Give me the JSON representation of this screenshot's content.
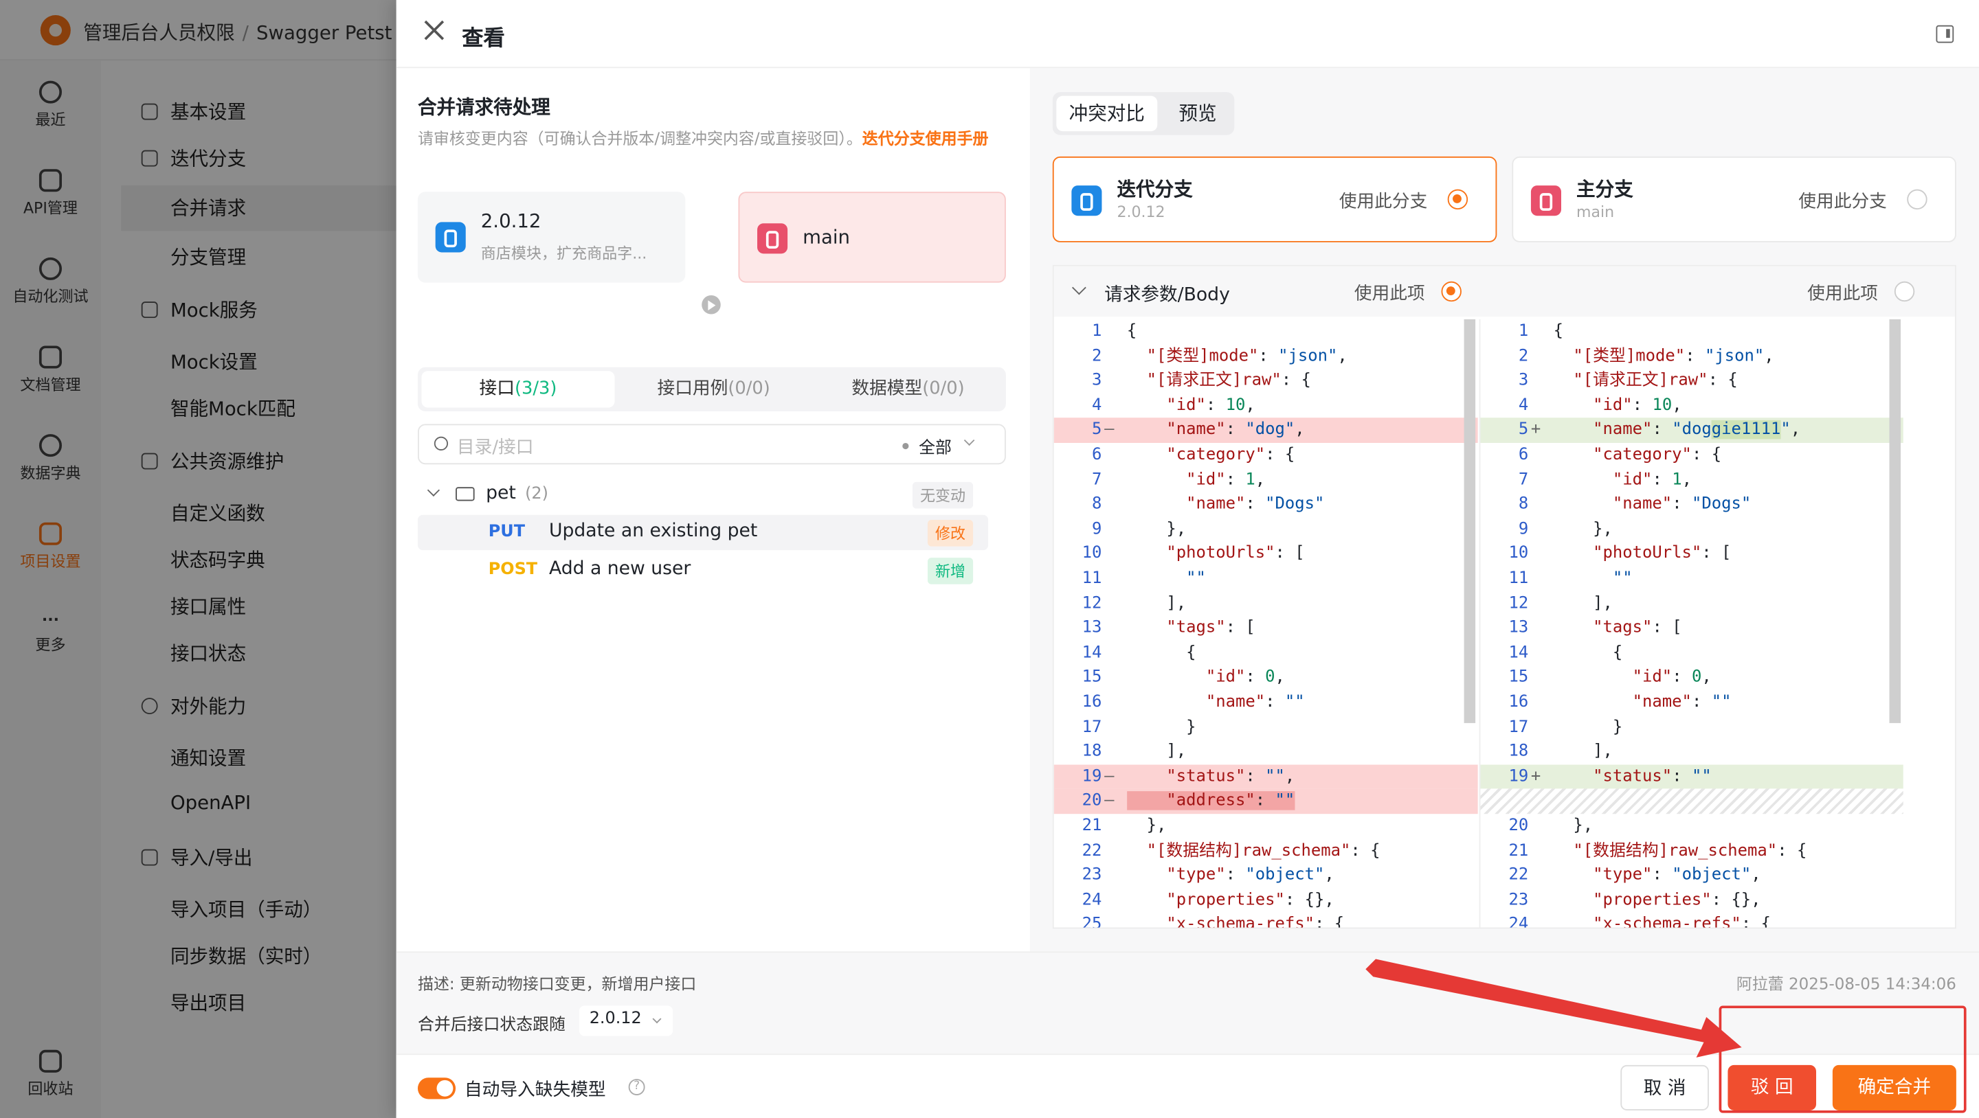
{
  "header": {
    "breadcrumb": [
      "管理后台人员权限",
      "Swagger Petst"
    ]
  },
  "rail": [
    {
      "label": "最近"
    },
    {
      "label": "API管理"
    },
    {
      "label": "自动化测试"
    },
    {
      "label": "文档管理"
    },
    {
      "label": "数据字典"
    },
    {
      "label": "项目设置"
    },
    {
      "label": "更多"
    },
    {
      "label": "回收站"
    }
  ],
  "menu": {
    "basic": "基本设置",
    "iter": "迭代分支",
    "merge": "合并请求",
    "branch": "分支管理",
    "mock": "Mock服务",
    "mockset": "Mock设置",
    "mockmatch": "智能Mock匹配",
    "public": "公共资源维护",
    "func": "自定义函数",
    "status": "状态码字典",
    "attr": "接口属性",
    "istate": "接口状态",
    "ext": "对外能力",
    "notify": "通知设置",
    "openapi": "OpenAPI",
    "io": "导入/导出",
    "importm": "导入项目（手动）",
    "sync": "同步数据（实时）",
    "export": "导出项目"
  },
  "drawer": {
    "title": "查看"
  },
  "left": {
    "heading": "合并请求待处理",
    "desc": "请审核变更内容（可确认合并版本/调整冲突内容/或直接驳回）。",
    "link": "迭代分支使用手册",
    "source": {
      "version": "2.0.12",
      "sub": "商店模块，扩充商品字..."
    },
    "target": {
      "name": "main"
    },
    "tabs": [
      {
        "label": "接口",
        "count": "(3/3)"
      },
      {
        "label": "接口用例",
        "count": "(0/0)"
      },
      {
        "label": "数据模型",
        "count": "(0/0)"
      }
    ],
    "search": {
      "placeholder": "目录/接口",
      "filter": "全部"
    },
    "folder": {
      "name": "pet",
      "count": "(2)",
      "badge": "无变动"
    },
    "rows": [
      {
        "method": "PUT",
        "name": "Update an existing pet",
        "badge": "修改"
      },
      {
        "method": "POST",
        "name": "Add a new user",
        "badge": "新增"
      }
    ]
  },
  "right": {
    "tabs": [
      "冲突对比",
      "预览"
    ],
    "branches": [
      {
        "title": "迭代分支",
        "sub": "2.0.12",
        "use": "使用此分支"
      },
      {
        "title": "主分支",
        "sub": "main",
        "use": "使用此分支"
      }
    ],
    "section": "请求参数/Body",
    "use_item": "使用此项"
  },
  "footer": {
    "desc": "描述: 更新动物接口变更，新增用户接口",
    "meta": "阿拉蕾 2025-08-05 14:34:06",
    "follow": "合并后接口状态跟随",
    "follow_value": "2.0.12",
    "auto": "自动导入缺失模型",
    "q": "?",
    "cancel": "取 消",
    "reject": "驳 回",
    "merge": "确定合并"
  },
  "colors": {
    "accent": "#f97316",
    "reject": "#f04e2f",
    "annotation": "#e53935"
  },
  "code_left": [
    [
      "1",
      "",
      "{"
    ],
    [
      "2",
      "",
      "  \"[类型]mode\": \"json\","
    ],
    [
      "3",
      "",
      "  \"[请求正文]raw\": {"
    ],
    [
      "4",
      "",
      "    \"id\": 10,"
    ],
    [
      "5",
      "—",
      "    \"name\": \"dog\","
    ],
    [
      "6",
      "",
      "    \"category\": {"
    ],
    [
      "7",
      "",
      "      \"id\": 1,"
    ],
    [
      "8",
      "",
      "      \"name\": \"Dogs\""
    ],
    [
      "9",
      "",
      "    },"
    ],
    [
      "10",
      "",
      "    \"photoUrls\": ["
    ],
    [
      "11",
      "",
      "      \"\""
    ],
    [
      "12",
      "",
      "    ],"
    ],
    [
      "13",
      "",
      "    \"tags\": ["
    ],
    [
      "14",
      "",
      "      {"
    ],
    [
      "15",
      "",
      "        \"id\": 0,"
    ],
    [
      "16",
      "",
      "        \"name\": \"\""
    ],
    [
      "17",
      "",
      "      }"
    ],
    [
      "18",
      "",
      "    ],"
    ],
    [
      "19",
      "—",
      "    \"status\": \"\","
    ],
    [
      "20",
      "—",
      "    \"address\": \"\""
    ],
    [
      "21",
      "",
      "  },"
    ],
    [
      "22",
      "",
      "  \"[数据结构]raw_schema\": {"
    ],
    [
      "23",
      "",
      "    \"type\": \"object\","
    ],
    [
      "24",
      "",
      "    \"properties\": {},"
    ],
    [
      "25",
      "",
      "    \"x-schema-refs\": {"
    ]
  ],
  "code_right": [
    [
      "1",
      "",
      "{"
    ],
    [
      "2",
      "",
      "  \"[类型]mode\": \"json\","
    ],
    [
      "3",
      "",
      "  \"[请求正文]raw\": {"
    ],
    [
      "4",
      "",
      "    \"id\": 10,"
    ],
    [
      "5",
      "+",
      "    \"name\": \"doggie1111\","
    ],
    [
      "6",
      "",
      "    \"category\": {"
    ],
    [
      "7",
      "",
      "      \"id\": 1,"
    ],
    [
      "8",
      "",
      "      \"name\": \"Dogs\""
    ],
    [
      "9",
      "",
      "    },"
    ],
    [
      "10",
      "",
      "    \"photoUrls\": ["
    ],
    [
      "11",
      "",
      "      \"\""
    ],
    [
      "12",
      "",
      "    ],"
    ],
    [
      "13",
      "",
      "    \"tags\": ["
    ],
    [
      "14",
      "",
      "      {"
    ],
    [
      "15",
      "",
      "        \"id\": 0,"
    ],
    [
      "16",
      "",
      "        \"name\": \"\""
    ],
    [
      "17",
      "",
      "      }"
    ],
    [
      "18",
      "",
      "    ],"
    ],
    [
      "19",
      "+",
      "    \"status\": \"\""
    ],
    [
      "",
      "",
      ""
    ],
    [
      "20",
      "",
      "  },"
    ],
    [
      "21",
      "",
      "  \"[数据结构]raw_schema\": {"
    ],
    [
      "22",
      "",
      "    \"type\": \"object\","
    ],
    [
      "23",
      "",
      "    \"properties\": {},"
    ],
    [
      "24",
      "",
      "    \"x-schema-refs\": {"
    ]
  ]
}
